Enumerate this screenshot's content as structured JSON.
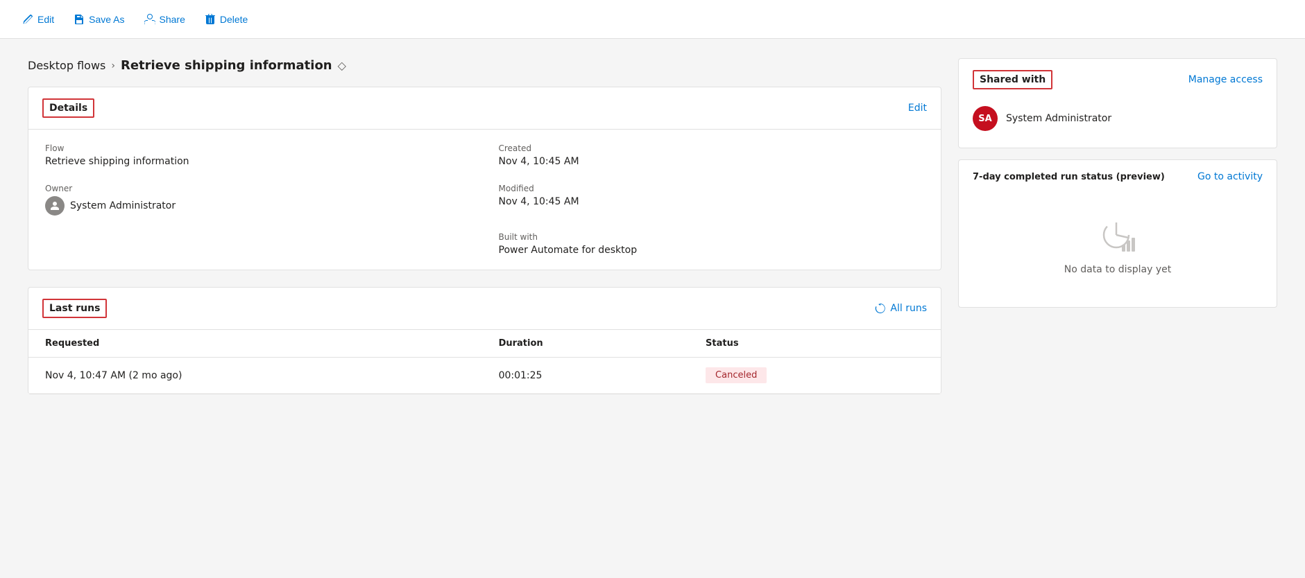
{
  "toolbar": {
    "edit_label": "Edit",
    "save_as_label": "Save As",
    "share_label": "Share",
    "delete_label": "Delete"
  },
  "breadcrumb": {
    "parent_label": "Desktop flows",
    "separator": ">",
    "current_label": "Retrieve shipping information"
  },
  "details_card": {
    "title": "Details",
    "edit_link": "Edit",
    "flow_label": "Flow",
    "flow_value": "Retrieve shipping information",
    "owner_label": "Owner",
    "owner_value": "System Administrator",
    "created_label": "Created",
    "created_value": "Nov 4, 10:45 AM",
    "modified_label": "Modified",
    "modified_value": "Nov 4, 10:45 AM",
    "built_with_label": "Built with",
    "built_with_value": "Power Automate for desktop"
  },
  "last_runs_card": {
    "title": "Last runs",
    "all_runs_label": "All runs",
    "columns": {
      "requested": "Requested",
      "duration": "Duration",
      "status": "Status"
    },
    "rows": [
      {
        "requested": "Nov 4, 10:47 AM (2 mo ago)",
        "duration": "00:01:25",
        "status": "Canceled"
      }
    ]
  },
  "shared_with_card": {
    "title": "Shared with",
    "manage_access_label": "Manage access",
    "users": [
      {
        "initials": "SA",
        "name": "System Administrator"
      }
    ]
  },
  "run_status_card": {
    "title": "7-day completed run status (preview)",
    "go_to_activity_label": "Go to activity",
    "no_data_label": "No data to display yet"
  },
  "icons": {
    "edit": "✏️",
    "save_as": "💾",
    "share": "☁️",
    "delete": "🗑️",
    "diamond": "◇",
    "refresh": "↻"
  }
}
